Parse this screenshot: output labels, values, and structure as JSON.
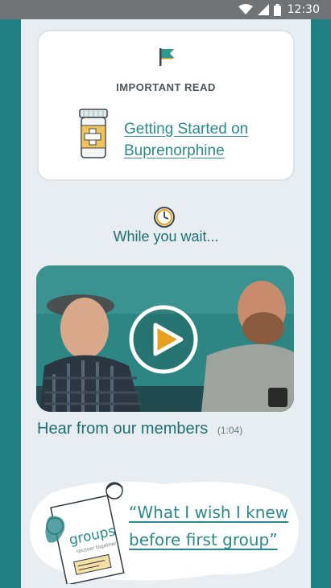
{
  "status_bar": {
    "time": "12:30",
    "icons": [
      "wifi-icon",
      "signal-icon",
      "battery-icon"
    ]
  },
  "important_card": {
    "eyebrow": "IMPORTANT READ",
    "link_text": "Getting Started on Buprenorphine",
    "icons": [
      "flag-icon",
      "pill-bottle-icon"
    ]
  },
  "wait_section": {
    "title": "While you wait...",
    "icon": "clock-icon"
  },
  "video": {
    "caption": "Hear from our members",
    "duration": "(1:04)",
    "icon": "play-icon"
  },
  "promo": {
    "link_text": "“What I wish I knew before first group”",
    "illustration_text": "groups",
    "illustration_subtext": "recover together"
  },
  "colors": {
    "teal": "#1f7f82",
    "link": "#2a8a8d",
    "panel": "#e7edf0",
    "accent_orange": "#e8a020"
  }
}
